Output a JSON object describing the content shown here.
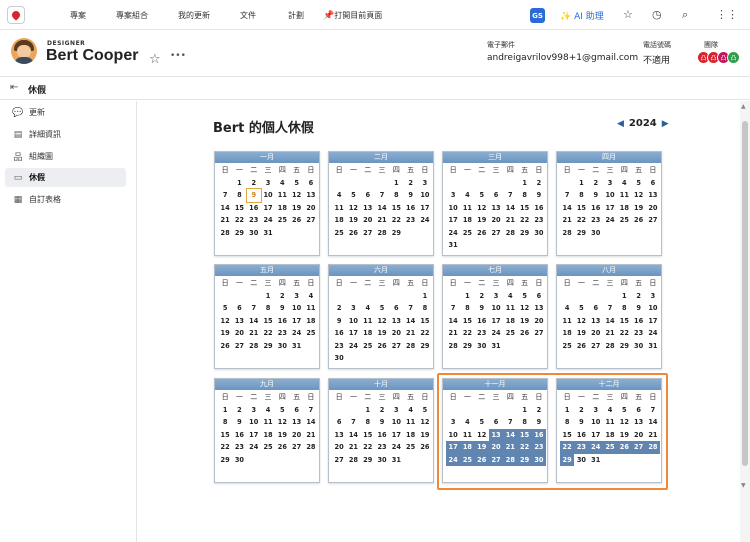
{
  "topbar": {
    "nav": [
      "專案",
      "專案組合",
      "我的更新",
      "文件",
      "計劃",
      "打開目前頁面"
    ],
    "gs_badge": "GS",
    "ai_label": "AI 助理",
    "icons": [
      "star-icon",
      "history-icon",
      "search-icon",
      "apps-grid-icon"
    ]
  },
  "profile": {
    "role": "DESIGNER",
    "name": "Bert Cooper",
    "email_label": "電子郵件",
    "email": "andreigavrilov998+1@gmail.com",
    "phone_label": "電話號碼",
    "phone": "不適用",
    "team_label": "團隊",
    "team": [
      {
        "initials": "凸",
        "color": "#d9232d"
      },
      {
        "initials": "凸",
        "color": "#d9232d"
      },
      {
        "initials": "凸",
        "color": "#c2185b"
      },
      {
        "initials": "凸",
        "color": "#2e9e4b"
      }
    ]
  },
  "breadcrumb": {
    "label": "休假"
  },
  "sidebar": {
    "items": [
      {
        "label": "更新",
        "icon": "chat-bubble-icon",
        "active": false
      },
      {
        "label": "詳細資訊",
        "icon": "document-icon",
        "active": false
      },
      {
        "label": "組織圖",
        "icon": "org-chart-icon",
        "active": false
      },
      {
        "label": "休假",
        "icon": "calendar-icon",
        "active": true
      },
      {
        "label": "自訂表格",
        "icon": "form-icon",
        "active": false
      }
    ]
  },
  "calendar": {
    "title": "Bert 的個人休假",
    "year": "2024",
    "weekdays": [
      "日",
      "一",
      "二",
      "三",
      "四",
      "五",
      "日"
    ],
    "months": [
      {
        "name": "一月",
        "start": 1,
        "days": 31,
        "today": 9,
        "off": []
      },
      {
        "name": "二月",
        "start": 4,
        "days": 29,
        "off": []
      },
      {
        "name": "三月",
        "start": 5,
        "days": 31,
        "off": []
      },
      {
        "name": "四月",
        "start": 1,
        "days": 30,
        "off": []
      },
      {
        "name": "五月",
        "start": 3,
        "days": 31,
        "off": []
      },
      {
        "name": "六月",
        "start": 6,
        "days": 30,
        "off": []
      },
      {
        "name": "七月",
        "start": 1,
        "days": 31,
        "off": []
      },
      {
        "name": "八月",
        "start": 4,
        "days": 31,
        "off": []
      },
      {
        "name": "九月",
        "start": 0,
        "days": 30,
        "off": []
      },
      {
        "name": "十月",
        "start": 2,
        "days": 31,
        "off": []
      },
      {
        "name": "十一月",
        "start": 5,
        "days": 30,
        "off": [
          13,
          14,
          15,
          16,
          17,
          18,
          19,
          20,
          21,
          22,
          23,
          24,
          25,
          26,
          27,
          28,
          29,
          30
        ]
      },
      {
        "name": "十二月",
        "start": 0,
        "days": 31,
        "off": [
          22,
          23,
          24,
          25,
          26,
          27,
          28,
          29
        ]
      }
    ]
  }
}
